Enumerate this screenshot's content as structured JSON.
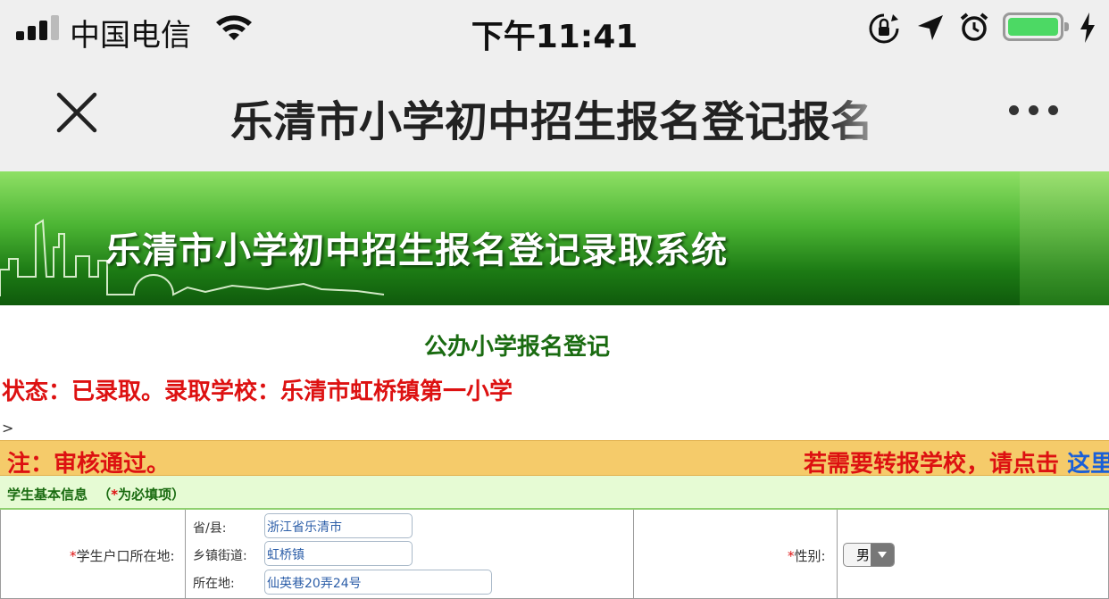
{
  "status_bar": {
    "carrier": "中国电信",
    "time": "下午11:41",
    "icons": [
      "signal-icon",
      "wifi-icon",
      "rotation-lock-icon",
      "location-arrow-icon",
      "alarm-icon",
      "battery-icon",
      "charging-icon"
    ]
  },
  "nav": {
    "title": "乐清市小学初中招生报名登记报名",
    "close_icon": "close-icon",
    "more_icon": "more-icon"
  },
  "banner": {
    "title": "乐清市小学初中招生报名登记录取系统"
  },
  "page": {
    "heading": "公办小学报名登记",
    "status": "状态：已录取。录取学校：乐清市虹桥镇第一小学",
    "caret": ">"
  },
  "notice": {
    "left": "注：审核通过。",
    "right_text": "若需要转报学校，请点击",
    "link": "这里"
  },
  "section": {
    "label": "学生基本信息",
    "required_note_open": "（",
    "required_star": "*",
    "required_note": "为必填项）"
  },
  "form": {
    "hukou_label": "学生户口所在地:",
    "star": "*",
    "province_label": "省/县:",
    "province_value": "浙江省乐清市",
    "town_label": "乡镇街道:",
    "town_value": "虹桥镇",
    "address_label": "所在地:",
    "address_value": "仙英巷20弄24号",
    "gender_label": "性别:",
    "gender_value": "男"
  },
  "colors": {
    "accent_red": "#dd1111",
    "heading_green": "#1a6b11",
    "notice_bg": "#f5cb6a",
    "link_blue": "#1a5fd8",
    "battery_green": "#4cd964"
  }
}
